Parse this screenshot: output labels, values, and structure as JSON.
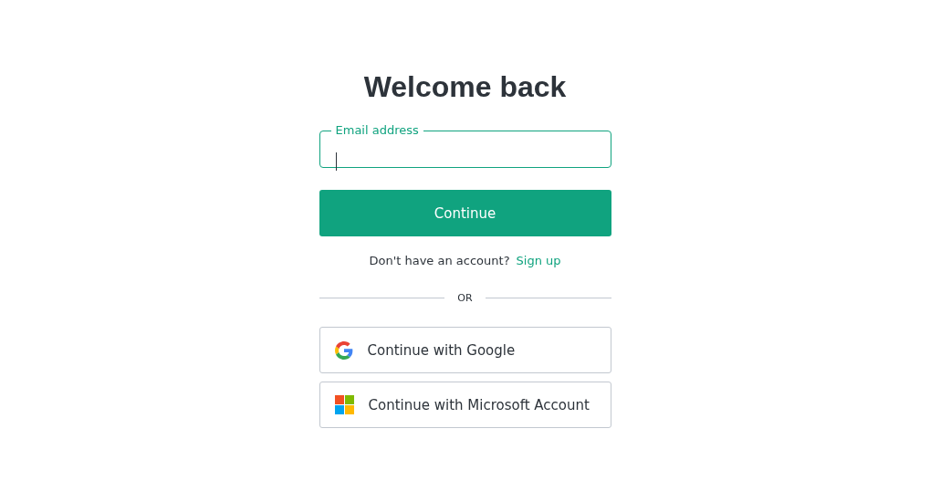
{
  "title": "Welcome back",
  "email_field": {
    "label": "Email address",
    "focused": true
  },
  "continue_button": "Continue",
  "signup_prompt": {
    "text": "Don't have an account?",
    "link": "Sign up"
  },
  "divider": "OR",
  "providers": [
    {
      "kind": "google",
      "label": "Continue with Google"
    },
    {
      "kind": "microsoft",
      "label": "Continue with Microsoft Account"
    }
  ]
}
